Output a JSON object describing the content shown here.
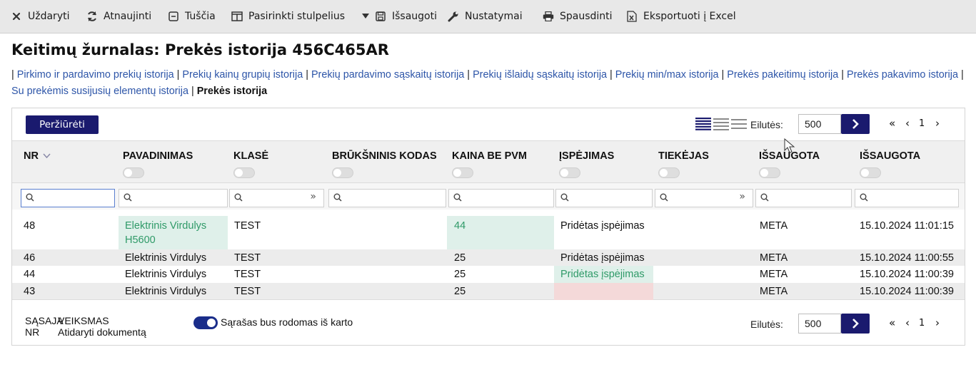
{
  "toolbar": {
    "close": "Uždaryti",
    "refresh": "Atnaujinti",
    "empty": "Tuščia",
    "columns": "Pasirinkti stulpelius",
    "save": "Išsaugoti",
    "settings": "Nustatymai",
    "print": "Spausdinti",
    "export": "Eksportuoti į Excel"
  },
  "page_title": "Keitimų žurnalas: Prekės istorija 456C465AR",
  "links": [
    "Pirkimo ir pardavimo prekių istorija",
    "Prekių kainų grupių istorija",
    "Prekių pardavimo sąskaitų istorija",
    "Prekių išlaidų sąskaitų istorija",
    "Prekių min/max istorija",
    "Prekės pakeitimų istorija",
    "Prekės pakavimo istorija",
    "Su prekėmis susijusių elementų istorija"
  ],
  "current_link": "Prekės istorija",
  "view_button": "Peržiūrėti",
  "rows_label": "Eilutės:",
  "rows_value": "500",
  "page_number": "1",
  "columns": [
    "NR",
    "PAVADINIMAS",
    "KLASĖ",
    "BRŪKŠNINIS KODAS",
    "KAINA BE PVM",
    "ĮSPĖJIMAS",
    "TIEKĖJAS",
    "IŠSAUGOTA",
    "IŠSAUGOTA"
  ],
  "rows": [
    {
      "nr": "48",
      "name_1": "Elektrinis Virdulys",
      "name_2": "H5600",
      "class": "TEST",
      "barcode": "",
      "price": "44",
      "warning": "Pridėtas įspėjimas",
      "supplier": "",
      "saved_by": "META",
      "saved_at": "15.10.2024 11:01:15"
    },
    {
      "nr": "46",
      "name_1": "Elektrinis Virdulys",
      "class": "TEST",
      "barcode": "",
      "price": "25",
      "warning": "Pridėtas įspėjimas",
      "supplier": "",
      "saved_by": "META",
      "saved_at": "15.10.2024 11:00:55"
    },
    {
      "nr": "44",
      "name_1": "Elektrinis Virdulys",
      "class": "TEST",
      "barcode": "",
      "price": "25",
      "warning": "Pridėtas įspėjimas",
      "supplier": "",
      "saved_by": "META",
      "saved_at": "15.10.2024 11:00:39"
    },
    {
      "nr": "43",
      "name_1": "Elektrinis Virdulys",
      "class": "TEST",
      "barcode": "",
      "price": "25",
      "warning": "",
      "supplier": "",
      "saved_by": "META",
      "saved_at": "15.10.2024 11:00:39"
    }
  ],
  "footer": {
    "col1_line1": "SĄSAJA",
    "col1_line2": "NR",
    "col2_line1": "VEIKSMAS",
    "col2_line2": "Atidaryti dokumentą",
    "toggle_label": "Sąrašas bus rodomas iš karto"
  },
  "colors": {
    "primary": "#1a1a6e",
    "link": "#2d55a8",
    "changed_green": "#2f9a68",
    "changed_bg": "#dff0ea",
    "removed_bg": "#f4d9d9"
  }
}
